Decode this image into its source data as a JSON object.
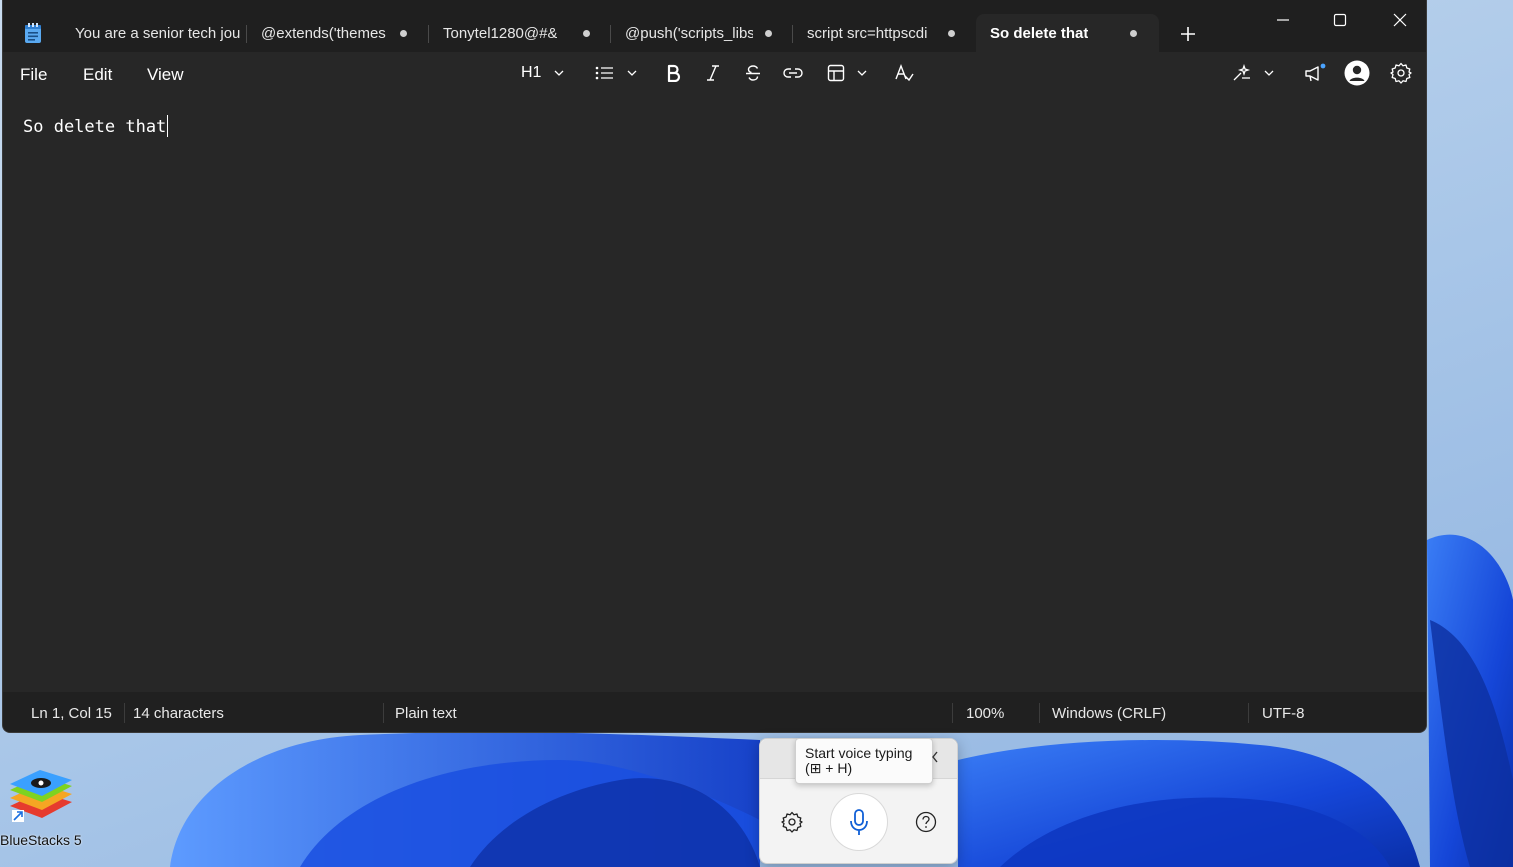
{
  "window": {
    "tabs": [
      {
        "title": "You are a senior tech jou",
        "active": false,
        "unsaved": false
      },
      {
        "title": "@extends('themes",
        "active": false,
        "unsaved": true
      },
      {
        "title": "Tonytel1280@#&",
        "active": false,
        "unsaved": true
      },
      {
        "title": "@push('scripts_libs",
        "active": false,
        "unsaved": true
      },
      {
        "title": "script src=httpscdi",
        "active": false,
        "unsaved": true
      },
      {
        "title": "So delete that",
        "active": true,
        "unsaved": true
      }
    ],
    "controls": [
      "minimize-icon",
      "maximize-icon",
      "close-icon"
    ]
  },
  "menu": {
    "file": "File",
    "edit": "Edit",
    "view": "View"
  },
  "toolbar": {
    "heading": "H1",
    "icons": [
      "list-icon",
      "bold-icon",
      "italic-icon",
      "strikethrough-icon",
      "link-icon",
      "table-icon",
      "clear-formatting-icon",
      "copilot-rewrite-icon",
      "notifications-icon",
      "account-icon",
      "settings-icon"
    ]
  },
  "editor": {
    "content": "So delete that"
  },
  "status": {
    "position": "Ln 1, Col 15",
    "characters": "14 characters",
    "format": "Plain text",
    "zoom": "100%",
    "line_ending": "Windows (CRLF)",
    "encoding": "UTF-8"
  },
  "desktop": {
    "shortcut_label": "BlueStacks 5"
  },
  "voice_typing": {
    "tooltip_line1": "Start voice typing",
    "tooltip_line2": "(⊞ + H)"
  },
  "colors": {
    "tabbar": "#1f1f1f",
    "surface": "#272727",
    "statusbar": "#202020",
    "text": "#ffffff",
    "accent": "#0f6cff"
  }
}
